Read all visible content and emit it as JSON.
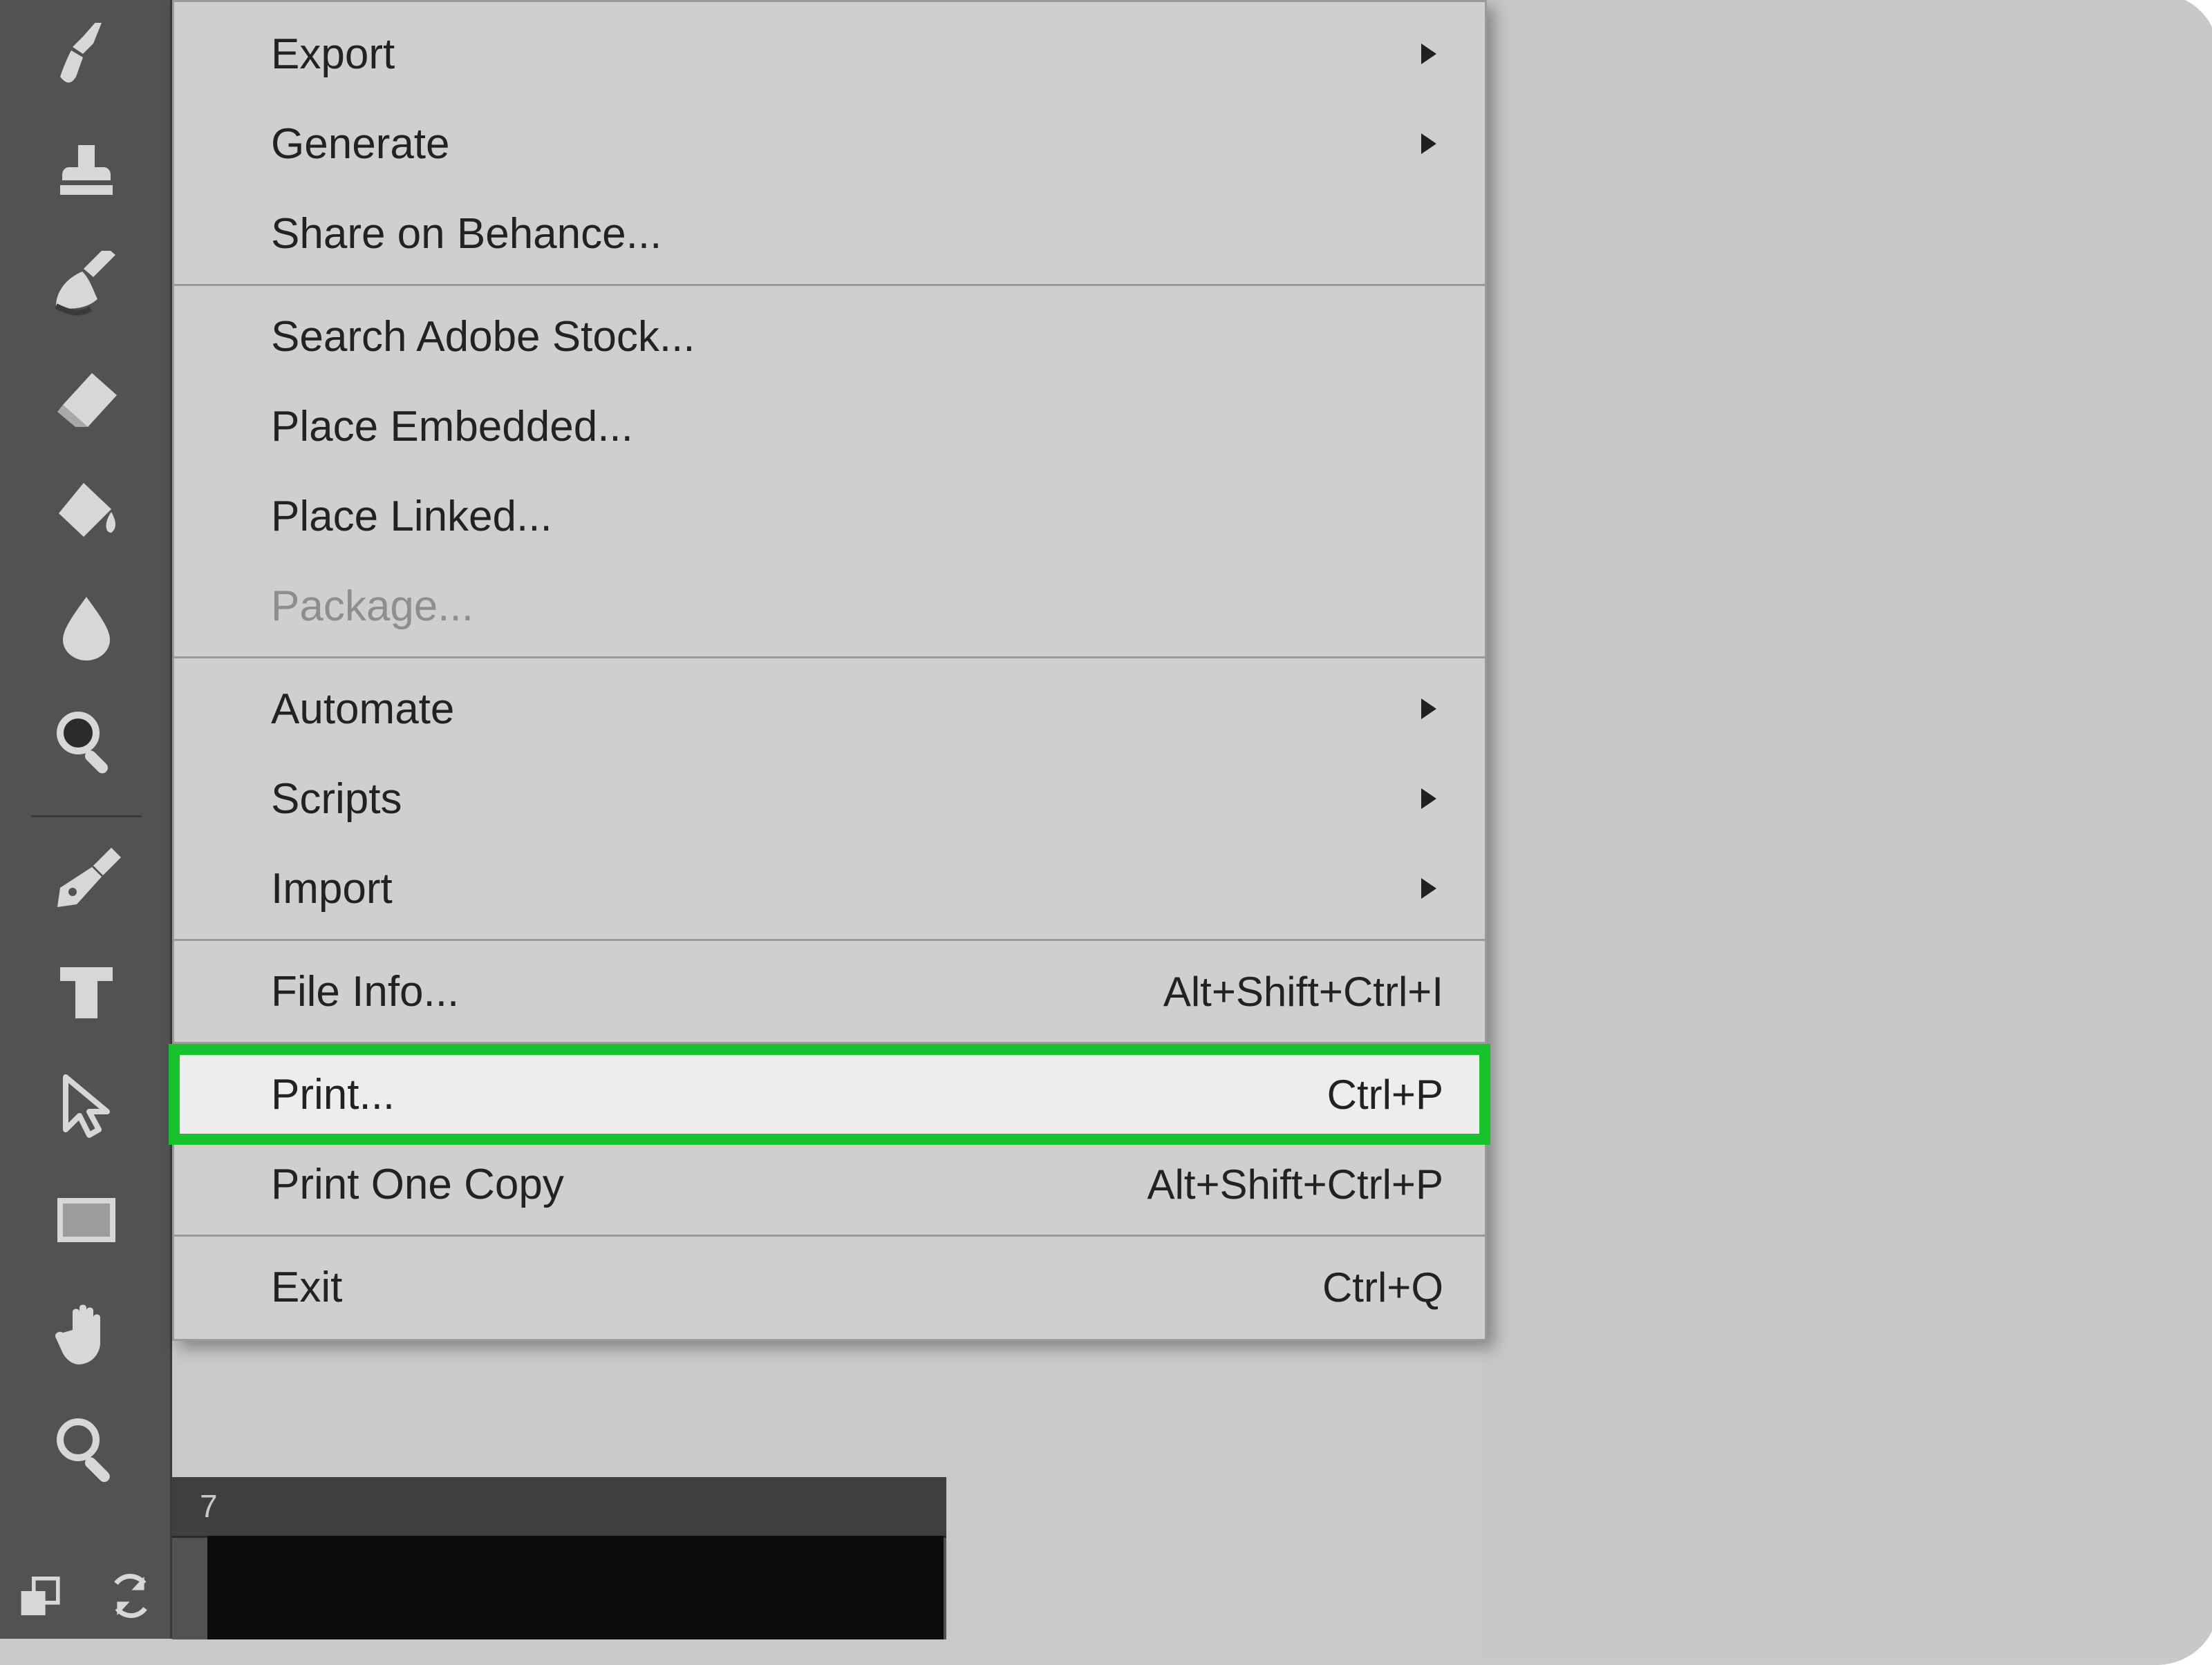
{
  "toolbar": {
    "tools": [
      "brush-tool",
      "stamp-tool",
      "history-brush-tool",
      "eraser-tool",
      "paint-bucket-tool",
      "blur-tool",
      "zoom-in-tool",
      "pen-tool",
      "type-tool",
      "path-selection-tool",
      "rectangle-tool",
      "hand-tool",
      "zoom-tool"
    ]
  },
  "ruler": {
    "mark": "7"
  },
  "menu": {
    "groups": [
      [
        {
          "name": "export",
          "label": "Export",
          "shortcut": "",
          "submenu": true
        },
        {
          "name": "generate",
          "label": "Generate",
          "shortcut": "",
          "submenu": true
        },
        {
          "name": "share-on-behance",
          "label": "Share on Behance...",
          "shortcut": ""
        }
      ],
      [
        {
          "name": "search-adobe-stock",
          "label": "Search Adobe Stock...",
          "shortcut": ""
        },
        {
          "name": "place-embedded",
          "label": "Place Embedded...",
          "shortcut": ""
        },
        {
          "name": "place-linked",
          "label": "Place Linked...",
          "shortcut": ""
        },
        {
          "name": "package",
          "label": "Package...",
          "shortcut": "",
          "disabled": true
        }
      ],
      [
        {
          "name": "automate",
          "label": "Automate",
          "shortcut": "",
          "submenu": true
        },
        {
          "name": "scripts",
          "label": "Scripts",
          "shortcut": "",
          "submenu": true
        },
        {
          "name": "import",
          "label": "Import",
          "shortcut": "",
          "submenu": true
        }
      ],
      [
        {
          "name": "file-info",
          "label": "File Info...",
          "shortcut": "Alt+Shift+Ctrl+I"
        }
      ],
      [
        {
          "name": "print",
          "label": "Print...",
          "shortcut": "Ctrl+P",
          "highlight": true
        },
        {
          "name": "print-one-copy",
          "label": "Print One Copy",
          "shortcut": "Alt+Shift+Ctrl+P"
        }
      ],
      [
        {
          "name": "exit",
          "label": "Exit",
          "shortcut": "Ctrl+Q"
        }
      ]
    ]
  }
}
